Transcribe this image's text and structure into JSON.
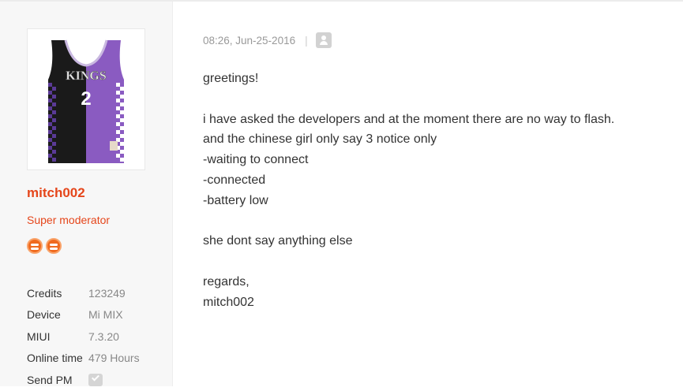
{
  "post": {
    "timestamp": "08:26, Jun-25-2016",
    "separator": "|",
    "lines": [
      "greetings!",
      "",
      "i have asked the developers and at the moment there are no way to flash.",
      "and the chinese girl only say 3 notice only",
      "-waiting to connect",
      "-connected",
      "-battery low",
      "",
      "she dont say anything else",
      "",
      "regards,",
      "mitch002"
    ]
  },
  "author": {
    "username": "mitch002",
    "role": "Super moderator",
    "avatar_number": "2",
    "avatar_text": "KINGS",
    "badges": [
      "medal-icon",
      "medal-icon"
    ],
    "stats": [
      {
        "label": "Credits",
        "value": "123249"
      },
      {
        "label": "Device",
        "value": "Mi MIX"
      },
      {
        "label": "MIUI",
        "value": "7.3.20"
      },
      {
        "label": "Online time",
        "value": "479 Hours"
      },
      {
        "label": "Send PM",
        "icon": "message-icon"
      }
    ]
  },
  "colors": {
    "accent": "#e5461b",
    "jersey_purple": "#8a5bc1",
    "jersey_black": "#1a1a1a"
  }
}
